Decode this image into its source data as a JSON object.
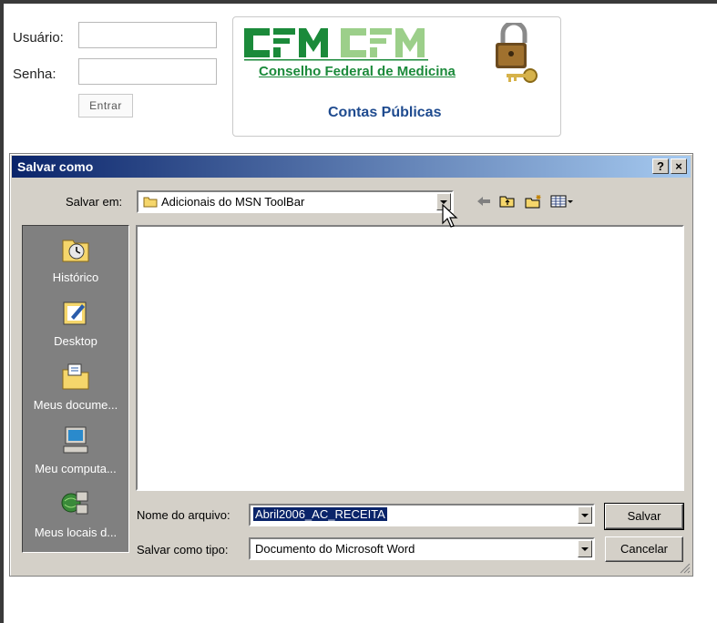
{
  "login": {
    "user_label": "Usuário:",
    "user_value": "",
    "pass_label": "Senha:",
    "pass_value": "",
    "enter_label": "Entrar"
  },
  "banner": {
    "logo_text": "CFM CFM",
    "council_name": "Conselho Federal de Medicina",
    "subtitle": "Contas Públicas",
    "icons": {
      "logo": "cfm-logo",
      "lock": "padlock-keys-icon"
    }
  },
  "dialog": {
    "title": "Salvar como",
    "help_button": "?",
    "close_button": "×",
    "save_in_label": "Salvar em:",
    "save_in_value": "Adicionais do MSN ToolBar",
    "toolbar_icons": [
      "back-arrow-icon",
      "up-folder-icon",
      "new-folder-icon",
      "view-menu-icon"
    ],
    "places": [
      {
        "label": "Histórico",
        "icon": "history-icon"
      },
      {
        "label": "Desktop",
        "icon": "desktop-icon"
      },
      {
        "label": "Meus docume...",
        "icon": "my-documents-icon"
      },
      {
        "label": "Meu computa...",
        "icon": "my-computer-icon"
      },
      {
        "label": "Meus locais d...",
        "icon": "network-places-icon"
      }
    ],
    "filename_label": "Nome do arquivo:",
    "filename_value": "Abril2006_AC_RECEITA",
    "filetype_label": "Salvar como tipo:",
    "filetype_value": "Documento do Microsoft Word",
    "save_button": "Salvar",
    "cancel_button": "Cancelar"
  },
  "colors": {
    "title_gradient_start": "#0a246a",
    "title_gradient_end": "#a6caf0",
    "dialog_face": "#d4d0c8",
    "places_bg": "#808080",
    "selection": "#0a246a",
    "cfm_green": "#1b8a3a",
    "subtitle_blue": "#1f4b8f"
  }
}
